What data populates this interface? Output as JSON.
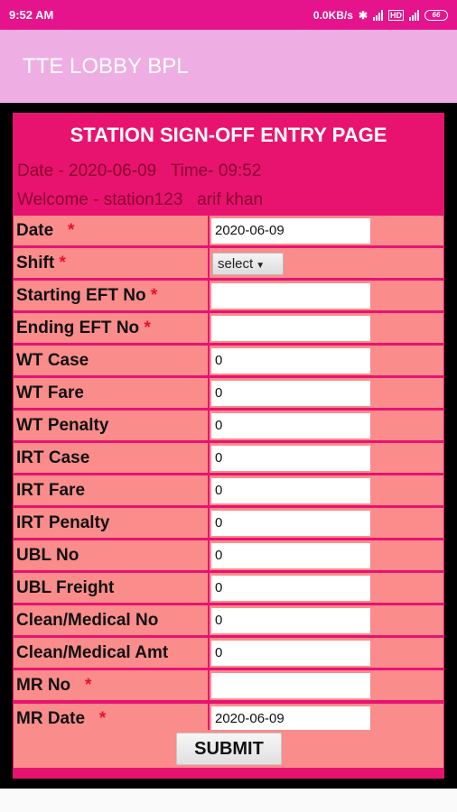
{
  "status_bar": {
    "time": "9:52 AM",
    "network_speed": "0.0KB/s",
    "battery": "66"
  },
  "app_bar": {
    "title": "TTE LOBBY BPL"
  },
  "header": {
    "title": "STATION SIGN-OFF ENTRY PAGE",
    "date_line": "Date - 2020-06-09   Time- 09:52",
    "welcome_line": "Welcome - station123   arif khan"
  },
  "fields": [
    {
      "label": "Date",
      "required": true,
      "value": "2020-06-09",
      "type": "input"
    },
    {
      "label": "Shift",
      "required": true,
      "value": "select",
      "type": "select"
    },
    {
      "label": "Starting EFT No",
      "required": true,
      "value": "",
      "type": "input"
    },
    {
      "label": "Ending EFT No",
      "required": true,
      "value": "",
      "type": "input"
    },
    {
      "label": "WT Case",
      "required": false,
      "value": "0",
      "type": "input"
    },
    {
      "label": "WT Fare",
      "required": false,
      "value": "0",
      "type": "input"
    },
    {
      "label": "WT Penalty",
      "required": false,
      "value": "0",
      "type": "input"
    },
    {
      "label": "IRT Case",
      "required": false,
      "value": "0",
      "type": "input"
    },
    {
      "label": "IRT Fare",
      "required": false,
      "value": "0",
      "type": "input"
    },
    {
      "label": "IRT Penalty",
      "required": false,
      "value": "0",
      "type": "input"
    },
    {
      "label": "UBL No",
      "required": false,
      "value": "0",
      "type": "input"
    },
    {
      "label": "UBL Freight",
      "required": false,
      "value": "0",
      "type": "input"
    },
    {
      "label": "Clean/Medical No",
      "required": false,
      "value": "0",
      "type": "input"
    },
    {
      "label": "Clean/Medical Amt",
      "required": false,
      "value": "0",
      "type": "input"
    },
    {
      "label": "MR No",
      "required": true,
      "value": "",
      "type": "input"
    },
    {
      "label": "MR Date",
      "required": true,
      "value": "2020-06-09",
      "type": "input"
    }
  ],
  "required_marker": "*",
  "submit_label": "SUBMIT",
  "colors": {
    "status_bar": "#e6148c",
    "app_bar": "#efaee3",
    "form_header": "#e8136f",
    "row_bg": "#fb8c8c",
    "required": "#e8132a"
  }
}
